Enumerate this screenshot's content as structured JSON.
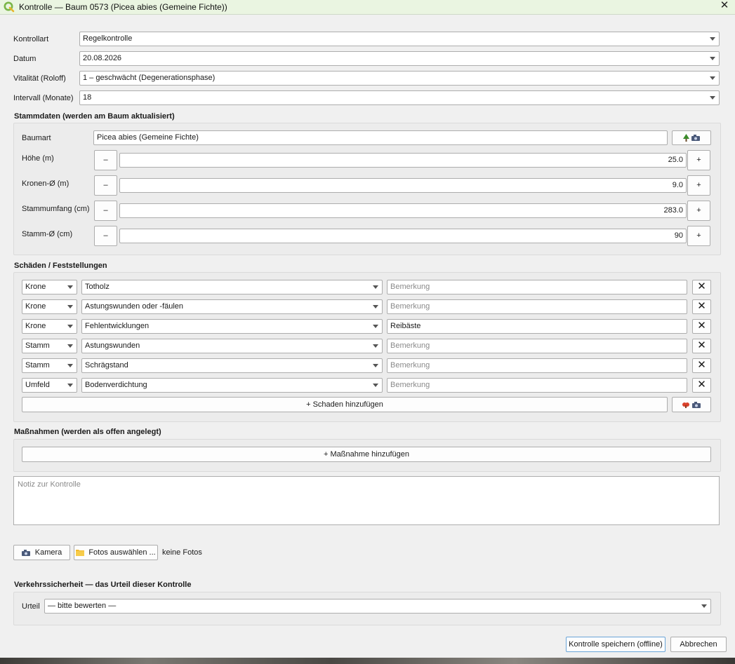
{
  "window": {
    "title": "Kontrolle — Baum 0573 (Picea abies (Gemeine Fichte))"
  },
  "fields": {
    "kontrollart": {
      "label": "Kontrollart",
      "value": "Regelkontrolle"
    },
    "datum": {
      "label": "Datum",
      "value": "20.08.2026"
    },
    "vitalitaet": {
      "label": "Vitalität (Roloff)",
      "value": "1 – geschwächt (Degenerationsphase)"
    },
    "intervall": {
      "label": "Intervall (Monate)",
      "value": "18"
    }
  },
  "stammdaten": {
    "title": "Stammdaten (werden am Baum aktualisiert)",
    "baumart": {
      "label": "Baumart",
      "value": "Picea abies (Gemeine Fichte)"
    },
    "rows": [
      {
        "label": "Höhe (m)",
        "value": "25.0"
      },
      {
        "label": "Kronen-Ø (m)",
        "value": "9.0"
      },
      {
        "label": "Stammumfang (cm)",
        "value": "283.0"
      },
      {
        "label": "Stamm-Ø (cm)",
        "value": "90"
      }
    ],
    "minus_label": "–",
    "plus_label": "+"
  },
  "schaeden": {
    "title": "Schäden / Feststellungen",
    "placeholder": "Bemerkung",
    "rows": [
      {
        "zone": "Krone",
        "type": "Totholz",
        "note": ""
      },
      {
        "zone": "Krone",
        "type": "Astungswunden oder -fäulen",
        "note": ""
      },
      {
        "zone": "Krone",
        "type": "Fehlentwicklungen",
        "note": "Reibäste"
      },
      {
        "zone": "Stamm",
        "type": "Astungswunden",
        "note": ""
      },
      {
        "zone": "Stamm",
        "type": "Schrägstand",
        "note": ""
      },
      {
        "zone": "Umfeld",
        "type": "Bodenverdichtung",
        "note": ""
      }
    ],
    "remove_label": "✕",
    "add_label": "+  Schaden hinzufügen"
  },
  "massnahmen": {
    "title": "Maßnahmen (werden als offen angelegt)",
    "add_label": "+  Maßnahme hinzufügen"
  },
  "notiz": {
    "placeholder": "Notiz zur Kontrolle"
  },
  "fotos": {
    "kamera_label": "Kamera",
    "auswaehlen_label": "Fotos auswählen ...",
    "status": "keine Fotos"
  },
  "verkehr": {
    "title": "Verkehrssicherheit — das Urteil dieser Kontrolle",
    "urteil_label": "Urteil",
    "urteil_value": "— bitte bewerten —"
  },
  "footer": {
    "save_label": "Kontrolle speichern (offline)",
    "cancel_label": "Abbrechen"
  },
  "colors": {
    "titlebar": "#eaf5e1",
    "accent": "#6aa5d8",
    "tree": "#3a8a2a",
    "damage": "#d9412b"
  },
  "icons": {
    "app": "qgis-icon",
    "tree": "tree-icon",
    "camera": "camera-icon",
    "folder": "folder-icon",
    "damage": "damage-icon"
  }
}
